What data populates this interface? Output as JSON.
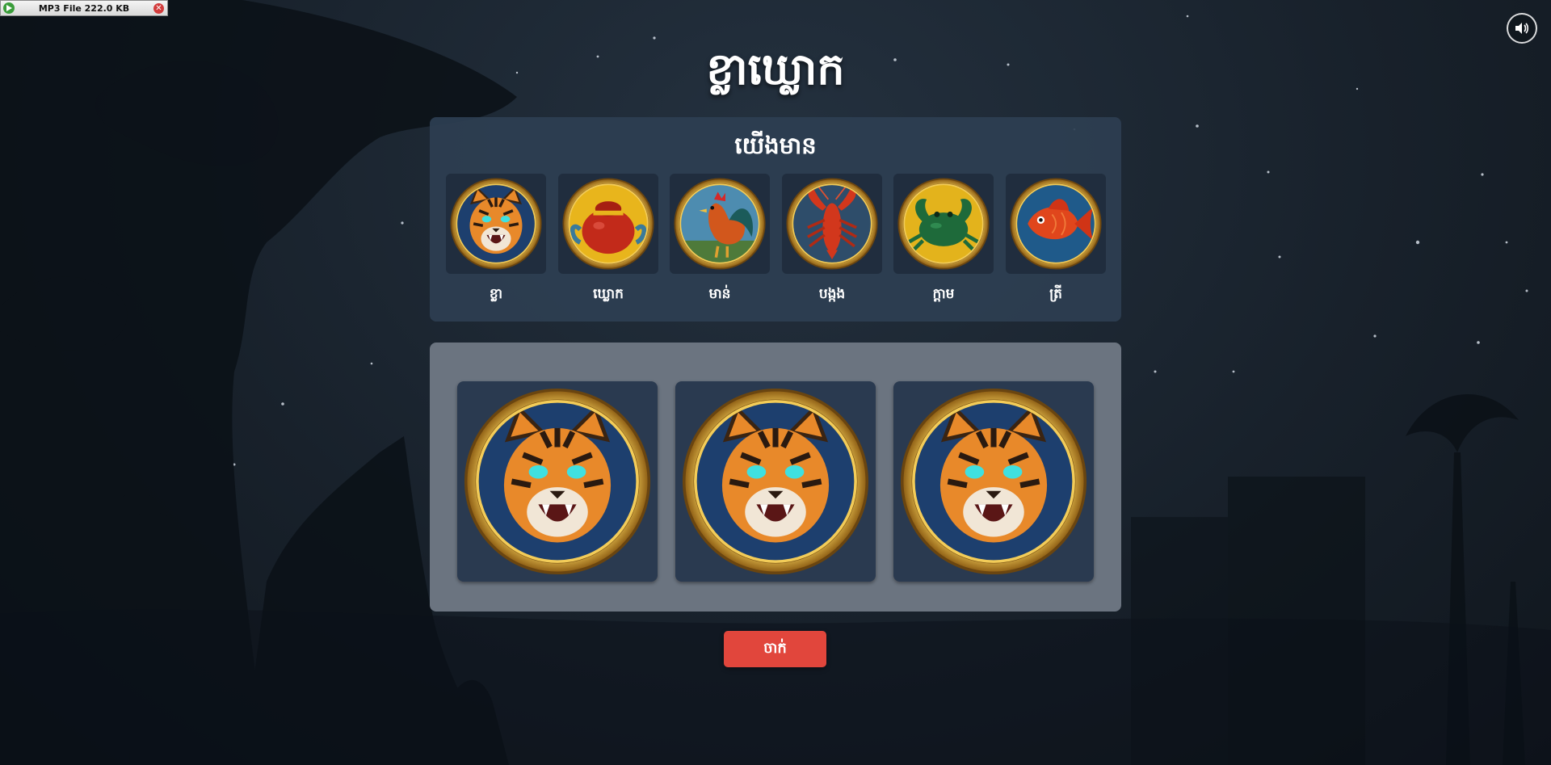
{
  "mp3_player": {
    "label": "MP3 File 222.0 KB",
    "play_icon": "play-icon",
    "close_icon": "close-icon"
  },
  "sound_button": {
    "icon": "speaker-icon"
  },
  "title": "ខ្លាឃ្លោក",
  "info_panel": {
    "heading": "យើងមាន",
    "symbols": [
      {
        "label": "ខ្លា",
        "icon": "tiger-icon"
      },
      {
        "label": "ឃ្លោក",
        "icon": "gourd-icon"
      },
      {
        "label": "មាន់",
        "icon": "rooster-icon"
      },
      {
        "label": "បង្កង",
        "icon": "lobster-icon"
      },
      {
        "label": "ក្តាម",
        "icon": "crab-icon"
      },
      {
        "label": "ត្រី",
        "icon": "fish-icon"
      }
    ]
  },
  "reels": [
    "tiger-icon",
    "tiger-icon",
    "tiger-icon"
  ],
  "roll_button": {
    "label": "ចាក់"
  },
  "colors": {
    "background": "#18212b",
    "panel": "#2d3e52",
    "board": "#6b7480",
    "reel_bg": "#2a3a50",
    "button": "#e1463c",
    "gold_rim": "#c9962b"
  }
}
